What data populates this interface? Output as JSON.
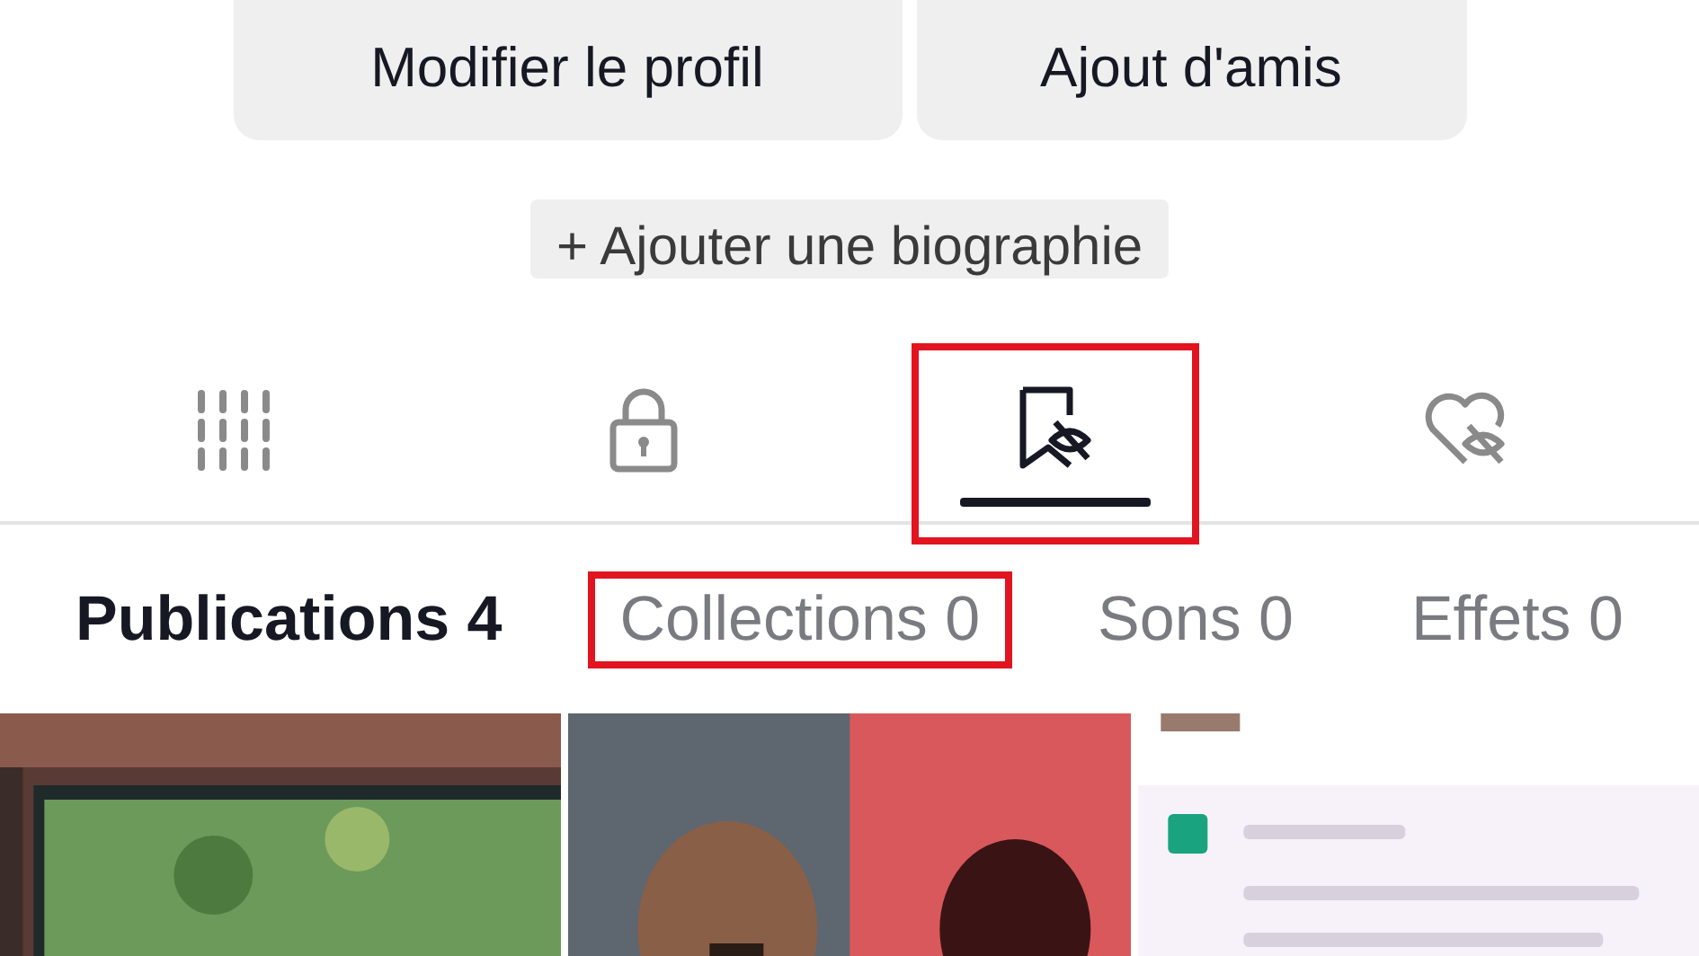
{
  "actions": [
    {
      "label": "Modifier le profil"
    },
    {
      "label": "Ajout d'amis"
    }
  ],
  "bio_button": {
    "label": "+ Ajouter une biographie"
  },
  "tabs": [
    {
      "kind": "grid",
      "selected": false,
      "highlighted": false
    },
    {
      "kind": "lock",
      "selected": false,
      "highlighted": false
    },
    {
      "kind": "bookmark",
      "selected": true,
      "highlighted": true
    },
    {
      "kind": "heart",
      "selected": false,
      "highlighted": false
    }
  ],
  "subtabs": [
    {
      "label": "Publications 4",
      "selected": true,
      "highlighted": false
    },
    {
      "label": "Collections 0",
      "selected": false,
      "highlighted": true
    },
    {
      "label": "Sons 0",
      "selected": false,
      "highlighted": false
    },
    {
      "label": "Effets 0",
      "selected": false,
      "highlighted": false
    }
  ]
}
